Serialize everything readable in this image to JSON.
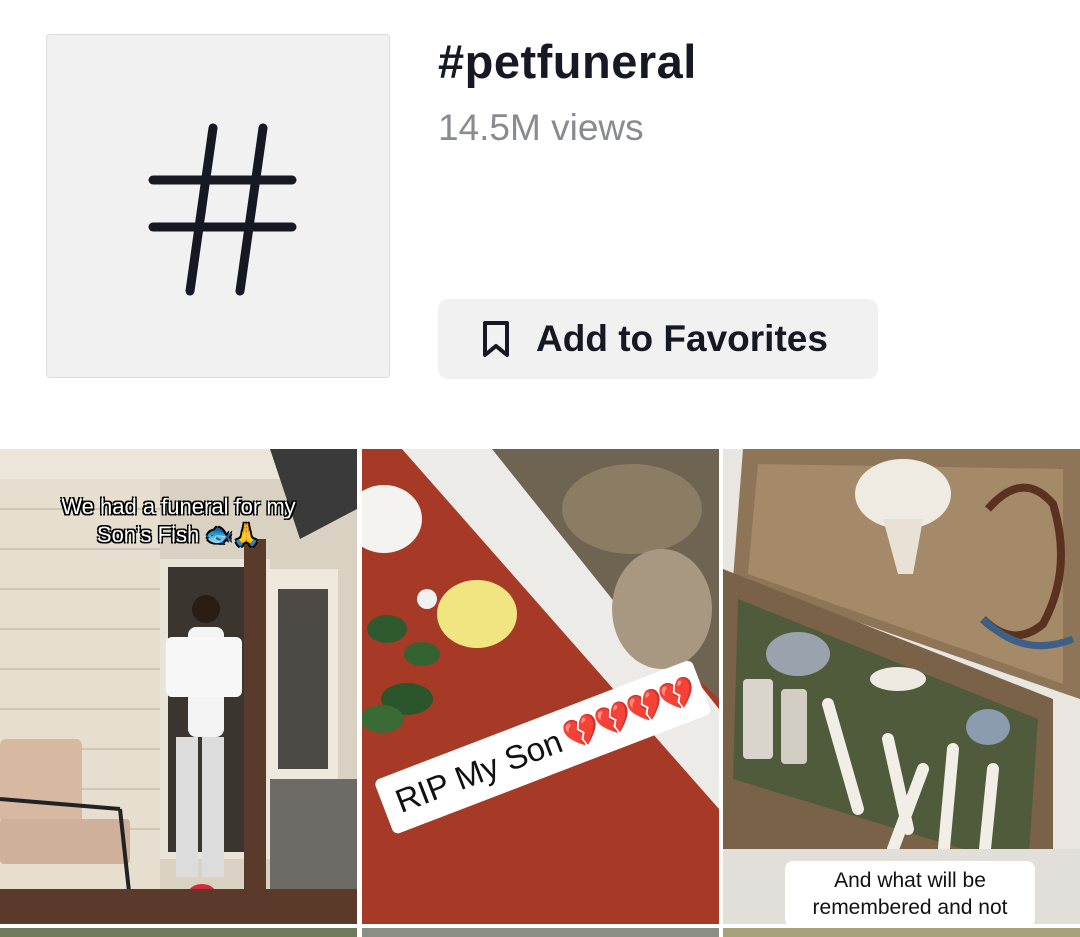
{
  "hashtag": {
    "icon": "hashtag-icon",
    "title": "#petfuneral",
    "views": "14.5M views",
    "favorite_button": {
      "icon": "bookmark-icon",
      "label": "Add to Favorites"
    }
  },
  "videos": [
    {
      "caption_line1": "We had a funeral for my",
      "caption_line2": "Son’s Fish 🐟🙏"
    },
    {
      "caption_text": "RIP My Son",
      "caption_emoji": "💔💔💔💔"
    },
    {
      "caption_line1": "And what will be",
      "caption_line2": "remembered and not"
    }
  ]
}
